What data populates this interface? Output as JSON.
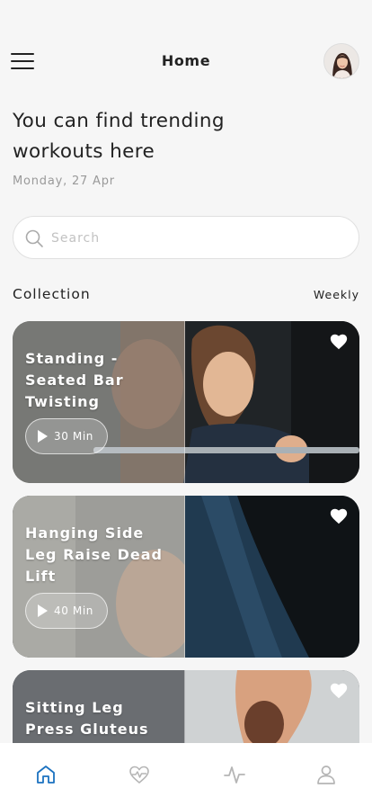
{
  "header": {
    "title": "Home",
    "menu_icon": "hamburger-menu-icon",
    "avatar_icon": "user-avatar"
  },
  "headline": "You can find trending workouts here",
  "date": "Monday, 27 Apr",
  "search": {
    "placeholder": "Search",
    "value": "",
    "icon": "search-icon"
  },
  "collection": {
    "title": "Collection",
    "filter": "Weekly"
  },
  "cards": [
    {
      "title": "Standing -Seated Bar Twisting",
      "duration": "30 Min",
      "favorited": true
    },
    {
      "title": "Hanging Side Leg Raise Dead Lift",
      "duration": "40 Min",
      "favorited": true
    },
    {
      "title": "Sitting Leg Press Gluteus Back",
      "duration": "",
      "favorited": true
    }
  ],
  "tabbar": {
    "items": [
      {
        "name": "home",
        "icon": "home-icon",
        "active": true
      },
      {
        "name": "health",
        "icon": "heart-rate-icon",
        "active": false
      },
      {
        "name": "activity",
        "icon": "activity-icon",
        "active": false
      },
      {
        "name": "profile",
        "icon": "user-icon",
        "active": false
      }
    ]
  },
  "colors": {
    "accent": "#1b72c0",
    "background": "#f6f6f6",
    "tab_inactive": "#b5b5b5",
    "text": "#1f1f1f"
  }
}
